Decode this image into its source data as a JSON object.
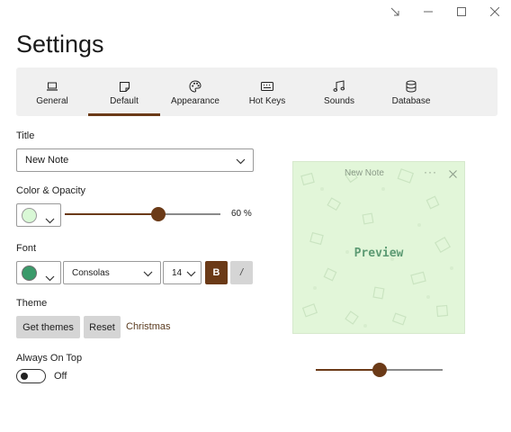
{
  "window": {
    "controls": [
      "restore-icon",
      "minimize-icon",
      "maximize-icon",
      "close-icon"
    ]
  },
  "page": {
    "title": "Settings"
  },
  "tabs": [
    {
      "label": "General",
      "icon": "laptop-icon",
      "active": false
    },
    {
      "label": "Default",
      "icon": "note-icon",
      "active": true
    },
    {
      "label": "Appearance",
      "icon": "palette-icon",
      "active": false
    },
    {
      "label": "Hot Keys",
      "icon": "keyboard-icon",
      "active": false
    },
    {
      "label": "Sounds",
      "icon": "music-note-icon",
      "active": false
    },
    {
      "label": "Database",
      "icon": "database-icon",
      "active": false
    }
  ],
  "title_section": {
    "label": "Title",
    "value": "New Note"
  },
  "color_section": {
    "label": "Color & Opacity",
    "swatch_color": "#d9f8d6",
    "opacity_percent": 60,
    "opacity_text": "60 %"
  },
  "font_section": {
    "label": "Font",
    "color": "#3a9a6a",
    "family": "Consolas",
    "size": "14",
    "bold_label": "B",
    "italic_label": "/",
    "bold_active": true,
    "italic_active": false
  },
  "theme_section": {
    "label": "Theme",
    "get_themes_label": "Get themes",
    "reset_label": "Reset",
    "current_theme": "Christmas"
  },
  "always_on_top": {
    "label": "Always On Top",
    "state": "Off",
    "enabled": false
  },
  "preview": {
    "title": "New Note",
    "dots": "···",
    "text": "Preview",
    "background": "#e2f6d9",
    "slider_level": 0.5
  },
  "colors": {
    "accent": "#6b3a17",
    "tab_bar_bg": "#f0f0f0",
    "button_gray": "#d5d5d5"
  }
}
